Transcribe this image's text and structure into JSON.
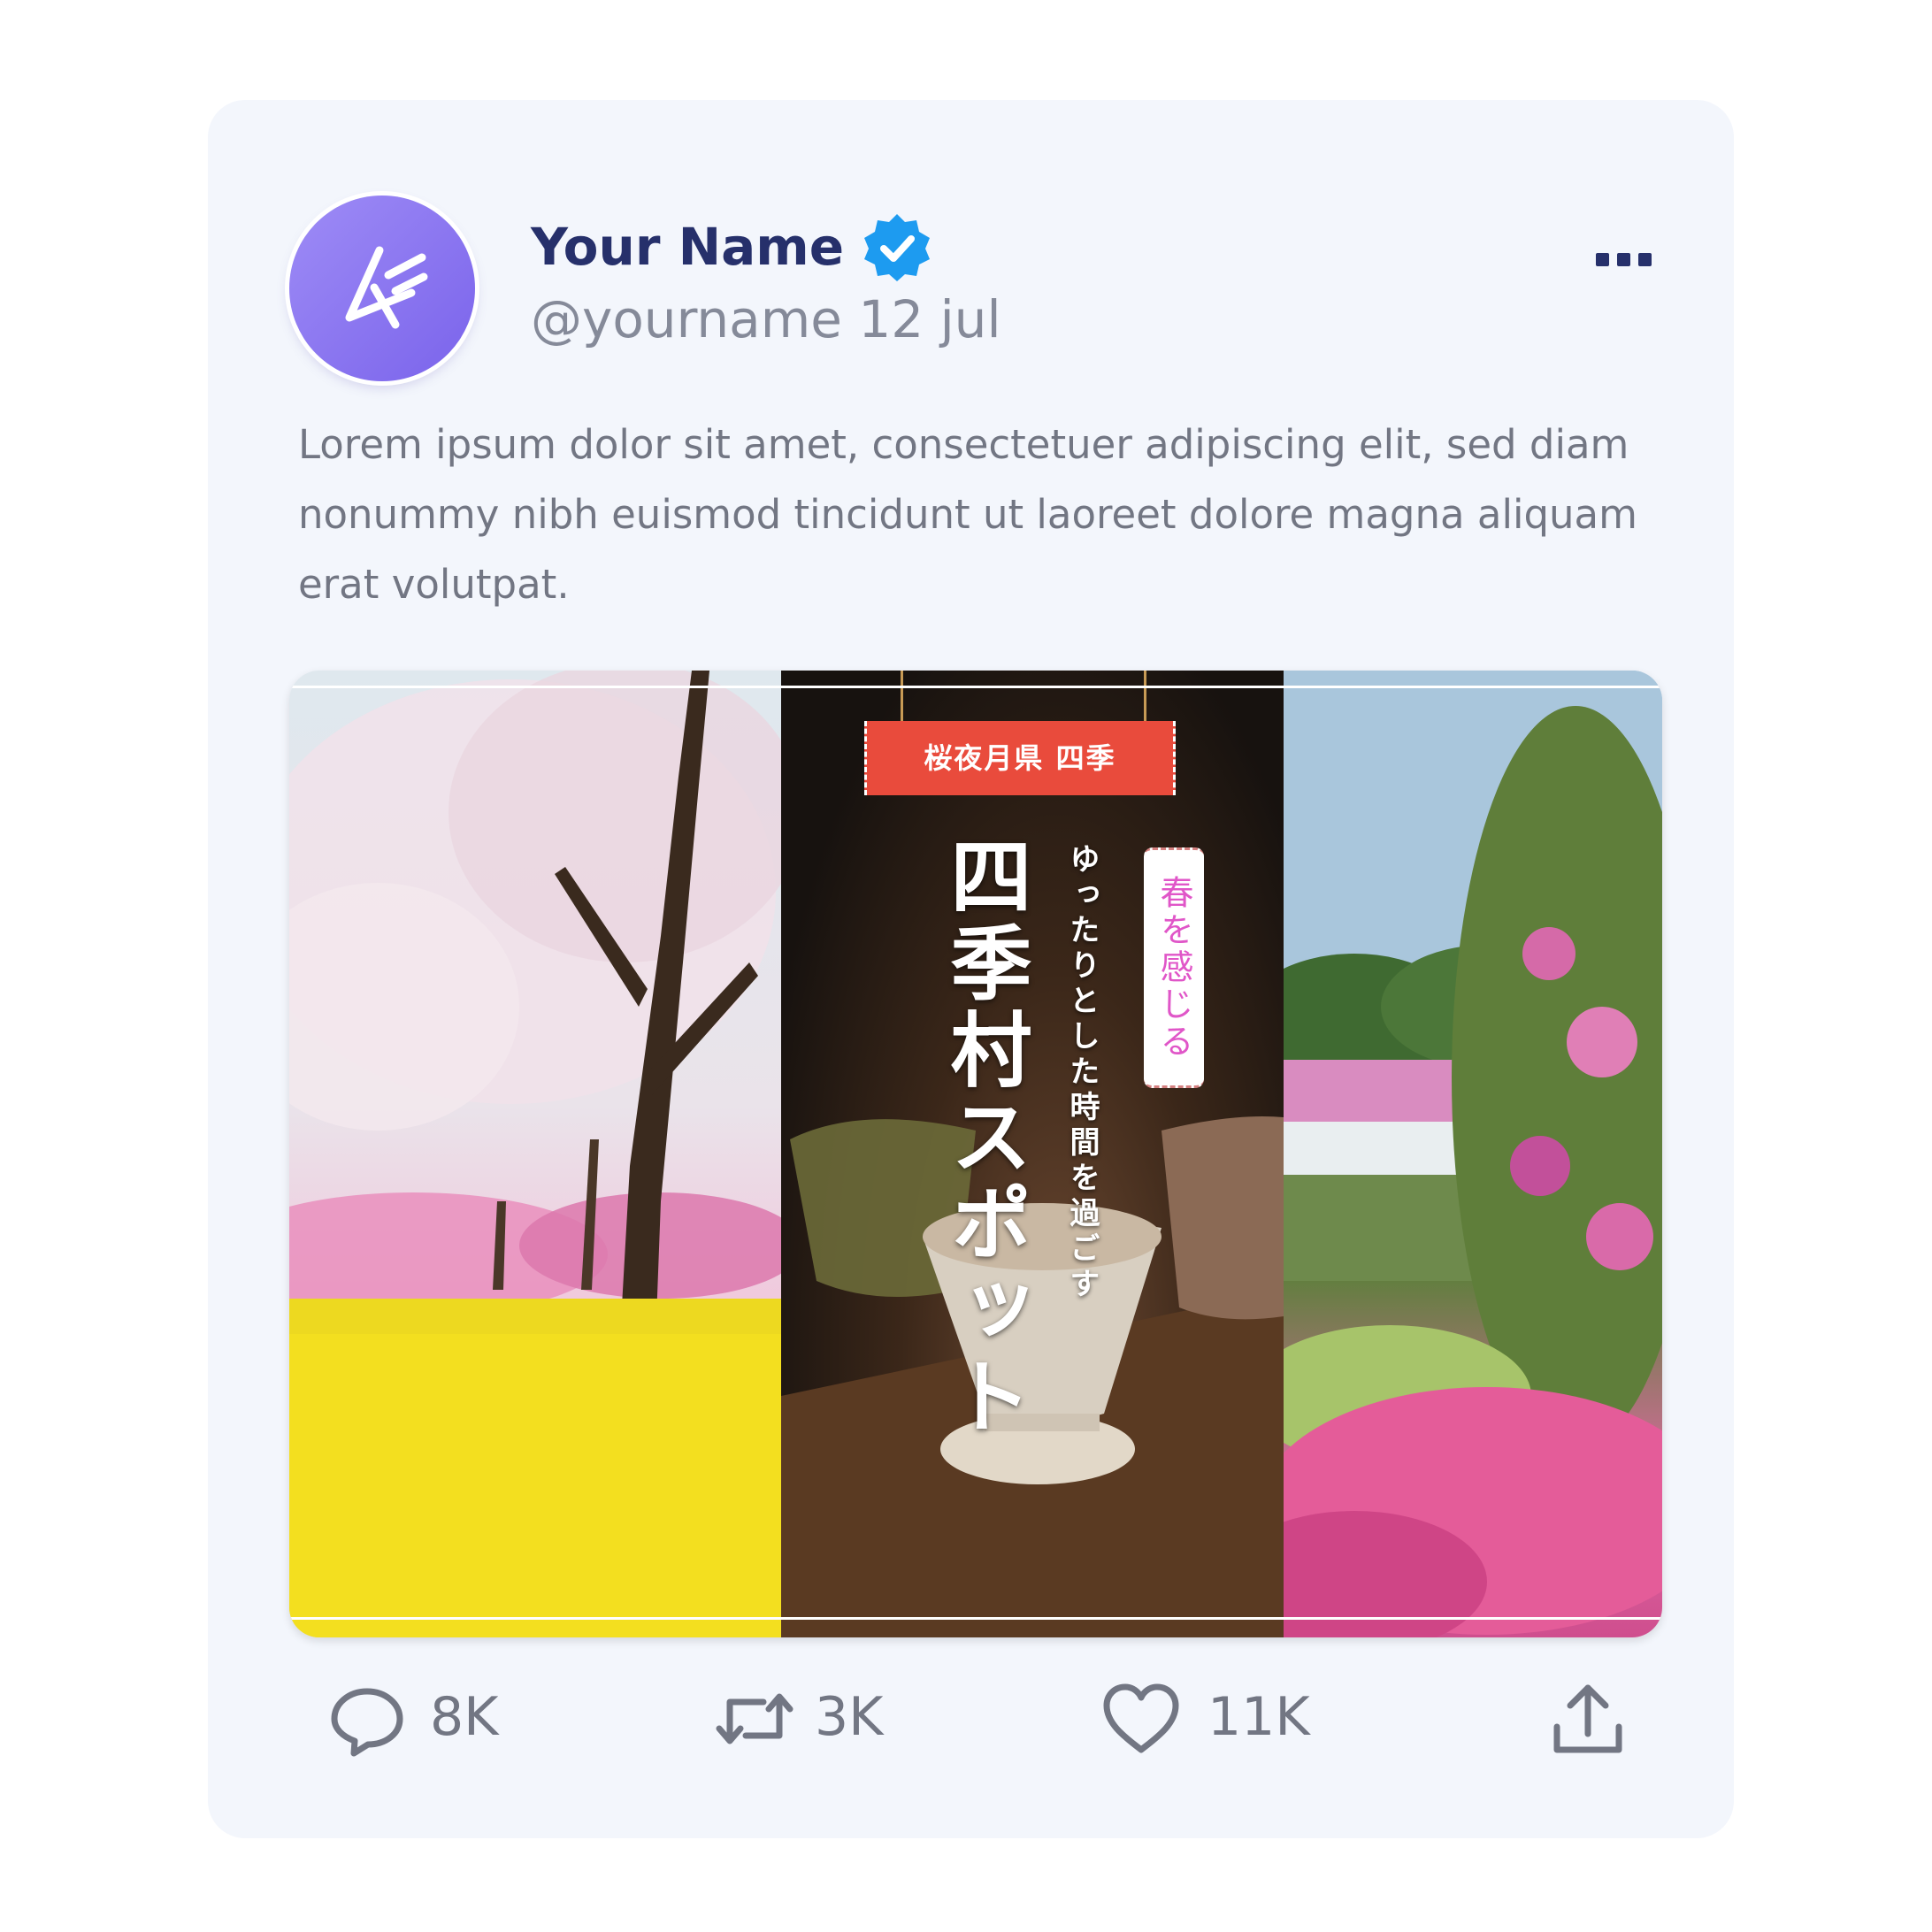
{
  "tweet": {
    "author_name": "Your Name",
    "handle": "@yourname",
    "date": "12 jul",
    "text": "Lorem ipsum dolor sit amet, consectetuer adipiscing elit, sed diam nonummy nibh euismod tincidunt ut laoreet dolore magna aliquam erat volutpat."
  },
  "media": {
    "label": "桜夜月県 四季",
    "title": "四季村スポット",
    "subtitle": "ゆったりとした時間を過ごす",
    "tag": "春を感じる"
  },
  "actions": {
    "replies": "8K",
    "retweets": "3K",
    "likes": "11K"
  },
  "colors": {
    "card_background": "#f3f6fc",
    "name": "#26306b",
    "verified": "#1d9bf0",
    "avatar": "#8b75f0",
    "secondary_text": "#727683",
    "label_red": "#e94b3c",
    "tag_pink": "#e056c8"
  },
  "icons": [
    "logo-icon",
    "verified-badge-icon",
    "more-icon",
    "reply-icon",
    "retweet-icon",
    "like-icon",
    "share-icon"
  ]
}
